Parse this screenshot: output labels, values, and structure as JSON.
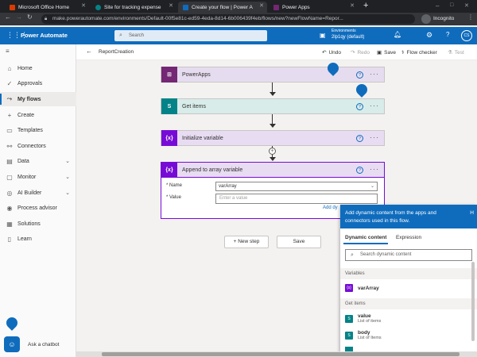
{
  "browser": {
    "tabs": [
      {
        "title": "Microsoft Office Home",
        "favicon_color": "#d83b01"
      },
      {
        "title": "Site for tracking expense",
        "favicon_color": "#038387"
      },
      {
        "title": "Create your flow | Power A",
        "favicon_color": "#0f6cbd"
      },
      {
        "title": "Power Apps",
        "favicon_color": "#742774"
      }
    ],
    "new_tab": "+",
    "url": "make.powerautomate.com/environments/Default-00f5e81c-ed59-4eda-8d14-6b006439f4eb/flows/new?newFlowName=Repor...",
    "incognito_label": "Incognito"
  },
  "header": {
    "app_name": "Power Automate",
    "search_placeholder": "Search",
    "environment_label": "Environments",
    "environment_name": "2lp1qy (default)",
    "avatar_initials": "CS"
  },
  "sidebar": {
    "items": [
      {
        "label": "Home",
        "icon": "home-icon",
        "glyph": "⌂"
      },
      {
        "label": "Approvals",
        "icon": "approvals-icon",
        "glyph": "✓"
      },
      {
        "label": "My flows",
        "icon": "flows-icon",
        "glyph": "⤳"
      },
      {
        "label": "Create",
        "icon": "plus-icon",
        "glyph": "+"
      },
      {
        "label": "Templates",
        "icon": "templates-icon",
        "glyph": "▭"
      },
      {
        "label": "Connectors",
        "icon": "connectors-icon",
        "glyph": "⚯"
      },
      {
        "label": "Data",
        "icon": "data-icon",
        "glyph": "▤"
      },
      {
        "label": "Monitor",
        "icon": "monitor-icon",
        "glyph": "▢"
      },
      {
        "label": "AI Builder",
        "icon": "ai-icon",
        "glyph": "◎"
      },
      {
        "label": "Process advisor",
        "icon": "process-icon",
        "glyph": "◉"
      },
      {
        "label": "Solutions",
        "icon": "solutions-icon",
        "glyph": "▦"
      },
      {
        "label": "Learn",
        "icon": "learn-icon",
        "glyph": "▯"
      }
    ],
    "chatbot_label": "Ask a chatbot"
  },
  "commandbar": {
    "flow_name": "ReportCreation",
    "undo": "Undo",
    "redo": "Redo",
    "save": "Save",
    "flow_checker": "Flow checker",
    "test": "Test"
  },
  "flow": {
    "steps": [
      {
        "title": "PowerApps",
        "icon_text": "⊞",
        "bg": "#e6dcef",
        "icon_bg": "#742774"
      },
      {
        "title": "Get items",
        "icon_text": "S",
        "bg": "#d8ece9",
        "icon_bg": "#038387"
      },
      {
        "title": "Initialize variable",
        "icon_text": "{x}",
        "bg": "#e8dcf3",
        "icon_bg": "#770bd6"
      },
      {
        "title": "Append to array variable",
        "icon_text": "{x}",
        "bg": "#e8dcf3",
        "icon_bg": "#770bd6"
      }
    ],
    "append": {
      "name_label": "* Name",
      "name_value": "varArray",
      "value_label": "* Value",
      "value_placeholder": "Enter a value",
      "add_dynamic_link": "Add dy"
    },
    "new_step": "+ New step",
    "save_button": "Save"
  },
  "dynamic_panel": {
    "header_text": "Add dynamic content from the apps and connectors used in this flow.",
    "hide_label": "H",
    "tab_dynamic": "Dynamic content",
    "tab_expression": "Expression",
    "search_placeholder": "Search dynamic content",
    "section_variables": "Variables",
    "var_item": "varArray",
    "section_get_items": "Get items",
    "items": [
      {
        "title": "value",
        "subtitle": "List of items"
      },
      {
        "title": "body",
        "subtitle": "List of Items"
      }
    ]
  }
}
